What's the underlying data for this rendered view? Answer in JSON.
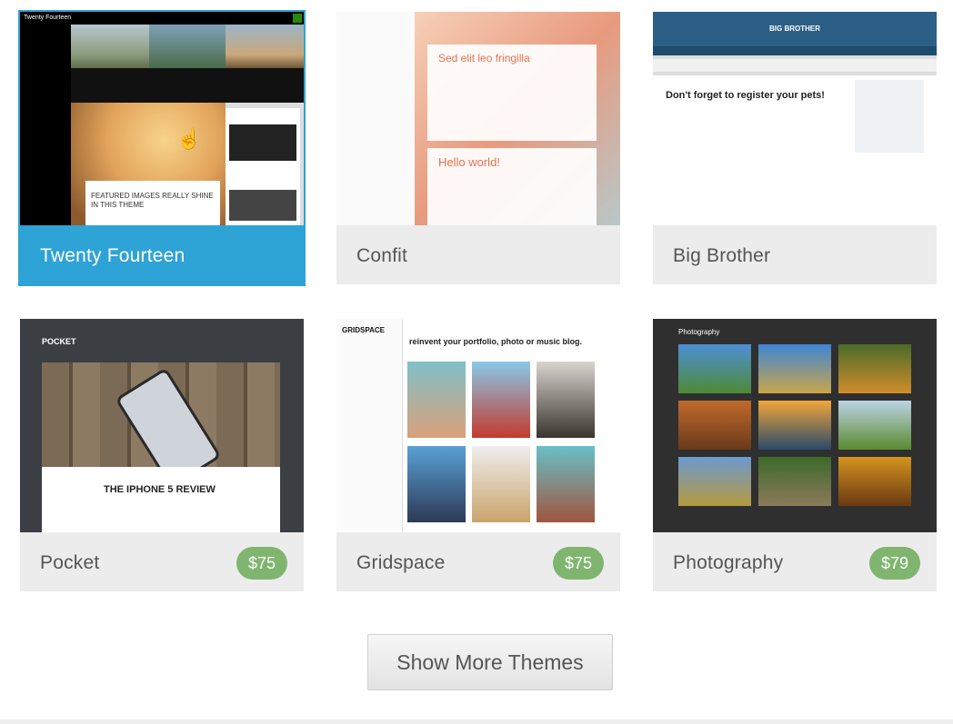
{
  "themes": [
    {
      "name": "Twenty Fourteen",
      "price": "",
      "active": true,
      "preview": {
        "site_title": "Twenty Fourteen",
        "post_title": "FEATURED IMAGES REALLY SHINE IN THIS THEME"
      }
    },
    {
      "name": "Confit",
      "price": "",
      "active": false,
      "preview": {
        "post1": "Sed elit leo fringilla",
        "post2": "Hello world!"
      }
    },
    {
      "name": "Big Brother",
      "price": "",
      "active": false,
      "preview": {
        "site_title": "BIG BROTHER",
        "post_title": "Don't forget to register your pets!"
      }
    },
    {
      "name": "Pocket",
      "price": "$75",
      "active": false,
      "preview": {
        "site_title": "POCKET",
        "post_title": "THE IPHONE 5 REVIEW"
      }
    },
    {
      "name": "Gridspace",
      "price": "$75",
      "active": false,
      "preview": {
        "site_title": "GRIDSPACE",
        "tagline": "reinvent your portfolio, photo or music blog."
      }
    },
    {
      "name": "Photography",
      "price": "$79",
      "active": false,
      "preview": {
        "site_title": "Photography"
      }
    }
  ],
  "show_more_label": "Show More Themes",
  "colors": {
    "accent": "#2ea3d6",
    "price_badge": "#80b56f",
    "caption_bg": "#ececec"
  }
}
